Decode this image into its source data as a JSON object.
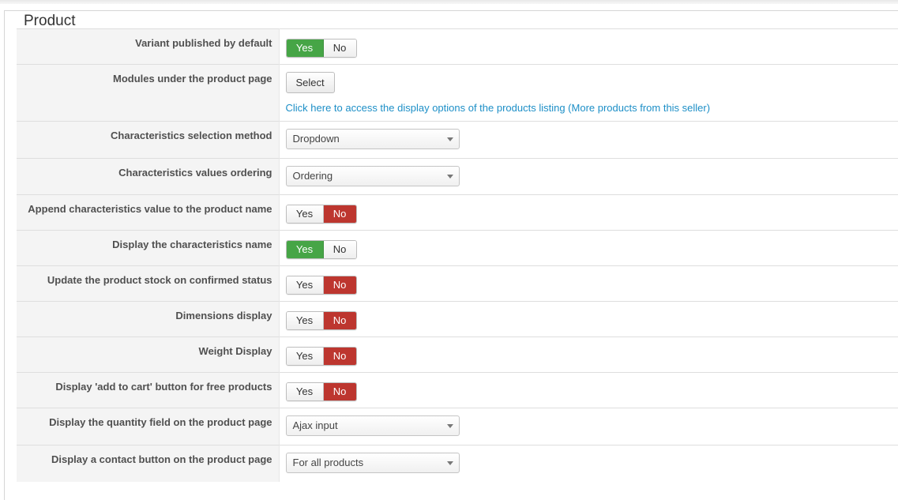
{
  "section": {
    "title": "Product"
  },
  "rows": {
    "variant_published": {
      "label": "Variant published by default",
      "yes": "Yes",
      "no": "No",
      "value": "Yes"
    },
    "modules": {
      "label": "Modules under the product page",
      "button": "Select",
      "link": "Click here to access the display options of the products listing (More products from this seller)"
    },
    "char_selection": {
      "label": "Characteristics selection method",
      "selected": "Dropdown"
    },
    "char_ordering": {
      "label": "Characteristics values ordering",
      "selected": "Ordering"
    },
    "append_char": {
      "label": "Append characteristics value to the product name",
      "yes": "Yes",
      "no": "No",
      "value": "No"
    },
    "display_char_name": {
      "label": "Display the characteristics name",
      "yes": "Yes",
      "no": "No",
      "value": "Yes"
    },
    "update_stock": {
      "label": "Update the product stock on confirmed status",
      "yes": "Yes",
      "no": "No",
      "value": "No"
    },
    "dimensions": {
      "label": "Dimensions display",
      "yes": "Yes",
      "no": "No",
      "value": "No"
    },
    "weight": {
      "label": "Weight Display",
      "yes": "Yes",
      "no": "No",
      "value": "No"
    },
    "add_to_cart_free": {
      "label": "Display 'add to cart' button for free products",
      "yes": "Yes",
      "no": "No",
      "value": "No"
    },
    "quantity_field": {
      "label": "Display the quantity field on the product page",
      "selected": "Ajax input"
    },
    "contact_button": {
      "label": "Display a contact button on the product page",
      "selected": "For all products"
    }
  },
  "colors": {
    "yes_active": "#46a546",
    "no_active": "#bd362f",
    "link": "#1d8fc7"
  }
}
